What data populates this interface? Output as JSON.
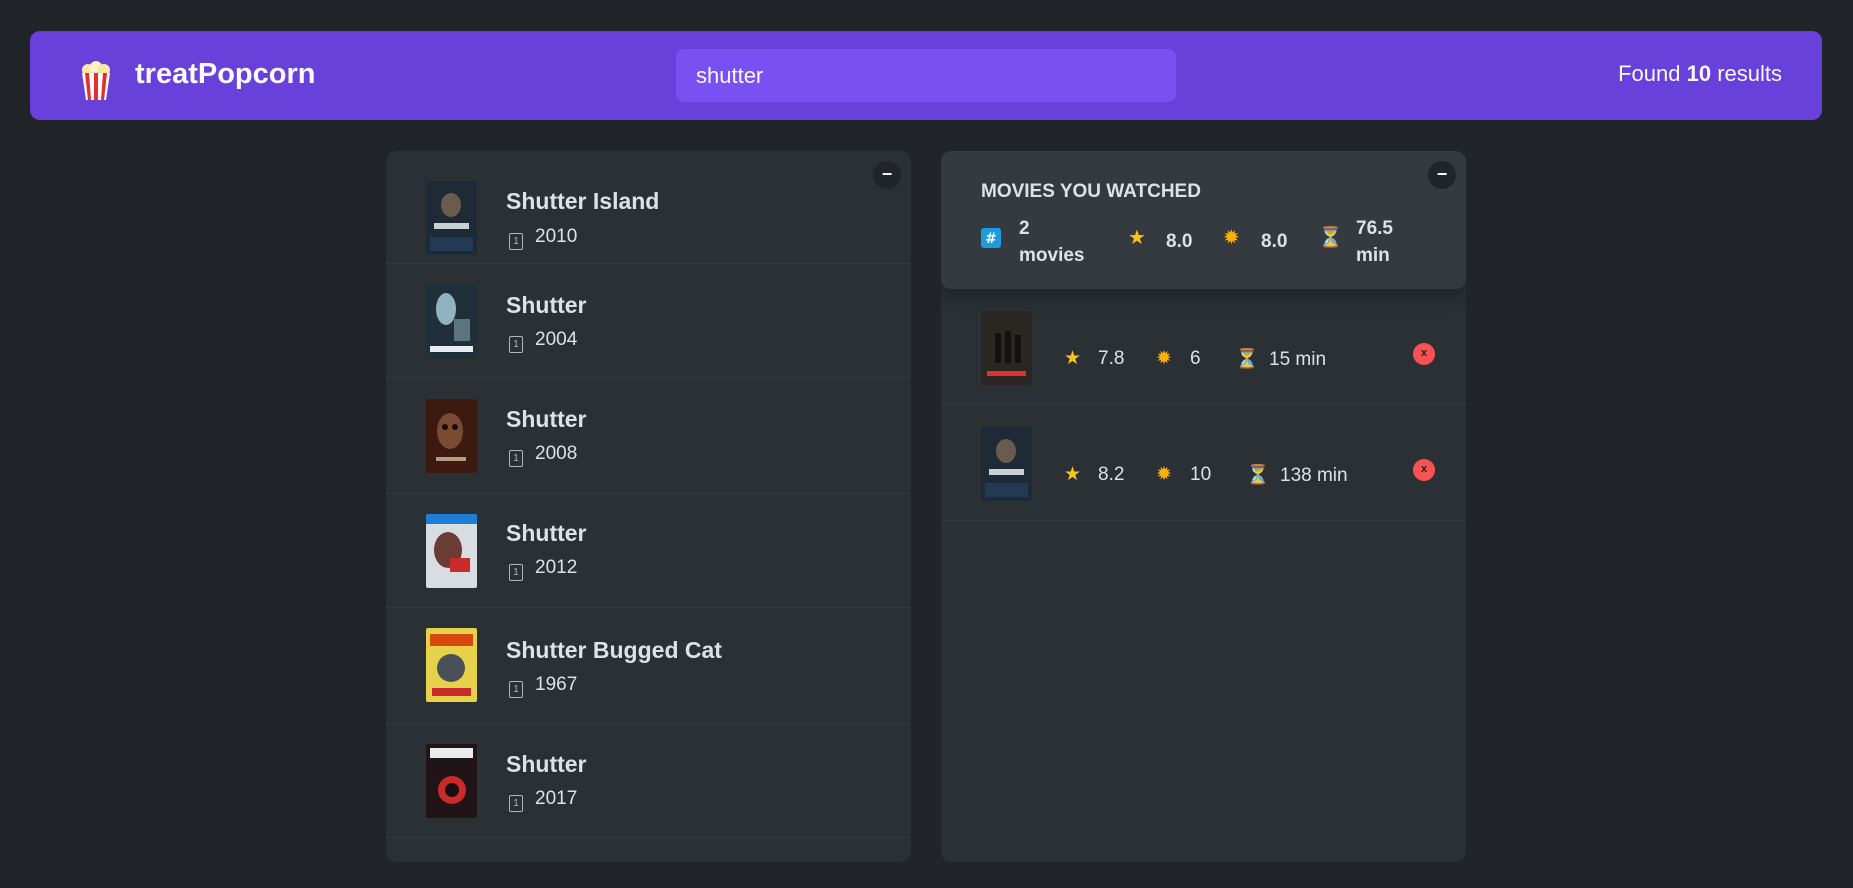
{
  "header": {
    "logo": "popcorn-icon",
    "brand": "treatPopcorn",
    "search_value": "shutter",
    "found_prefix": "Found",
    "found_count": "10",
    "found_suffix": "results"
  },
  "results": {
    "toggle_label": "−",
    "items": [
      {
        "title": "Shutter Island",
        "year": "2010",
        "poster_color": "#1e2a36"
      },
      {
        "title": "Shutter",
        "year": "2004",
        "poster_color": "#20303a"
      },
      {
        "title": "Shutter",
        "year": "2008",
        "poster_color": "#3d1a10"
      },
      {
        "title": "Shutter",
        "year": "2012",
        "poster_color": "#4a2a24"
      },
      {
        "title": "Shutter Bugged Cat",
        "year": "1967",
        "poster_color": "#e5d24a"
      },
      {
        "title": "Shutter",
        "year": "2017",
        "poster_color": "#201417"
      }
    ]
  },
  "summary": {
    "toggle_label": "−",
    "heading": "Movies you watched",
    "count_value": "2",
    "count_unit": "movies",
    "imdb_avg": "8.0",
    "user_avg": "8.0",
    "runtime_value": "76.5",
    "runtime_unit": "min"
  },
  "watched": [
    {
      "imdb": "7.8",
      "user": "6",
      "runtime": "15 min",
      "delete_label": "x",
      "poster_color": "#2a2622"
    },
    {
      "imdb": "8.2",
      "user": "10",
      "runtime": "138 min",
      "delete_label": "x",
      "poster_color": "#1e2a36"
    }
  ],
  "icons": {
    "calendar": "🗓",
    "hash": "#️⃣",
    "star": "⭐",
    "sun": "🌟",
    "hourglass": "⏳"
  },
  "colors": {
    "accent": "#6741d9",
    "search_bg": "#7950f2",
    "background": "#212529",
    "box_bg": "#2b3035",
    "summary_bg": "#343a40",
    "delete": "#fa5252"
  }
}
